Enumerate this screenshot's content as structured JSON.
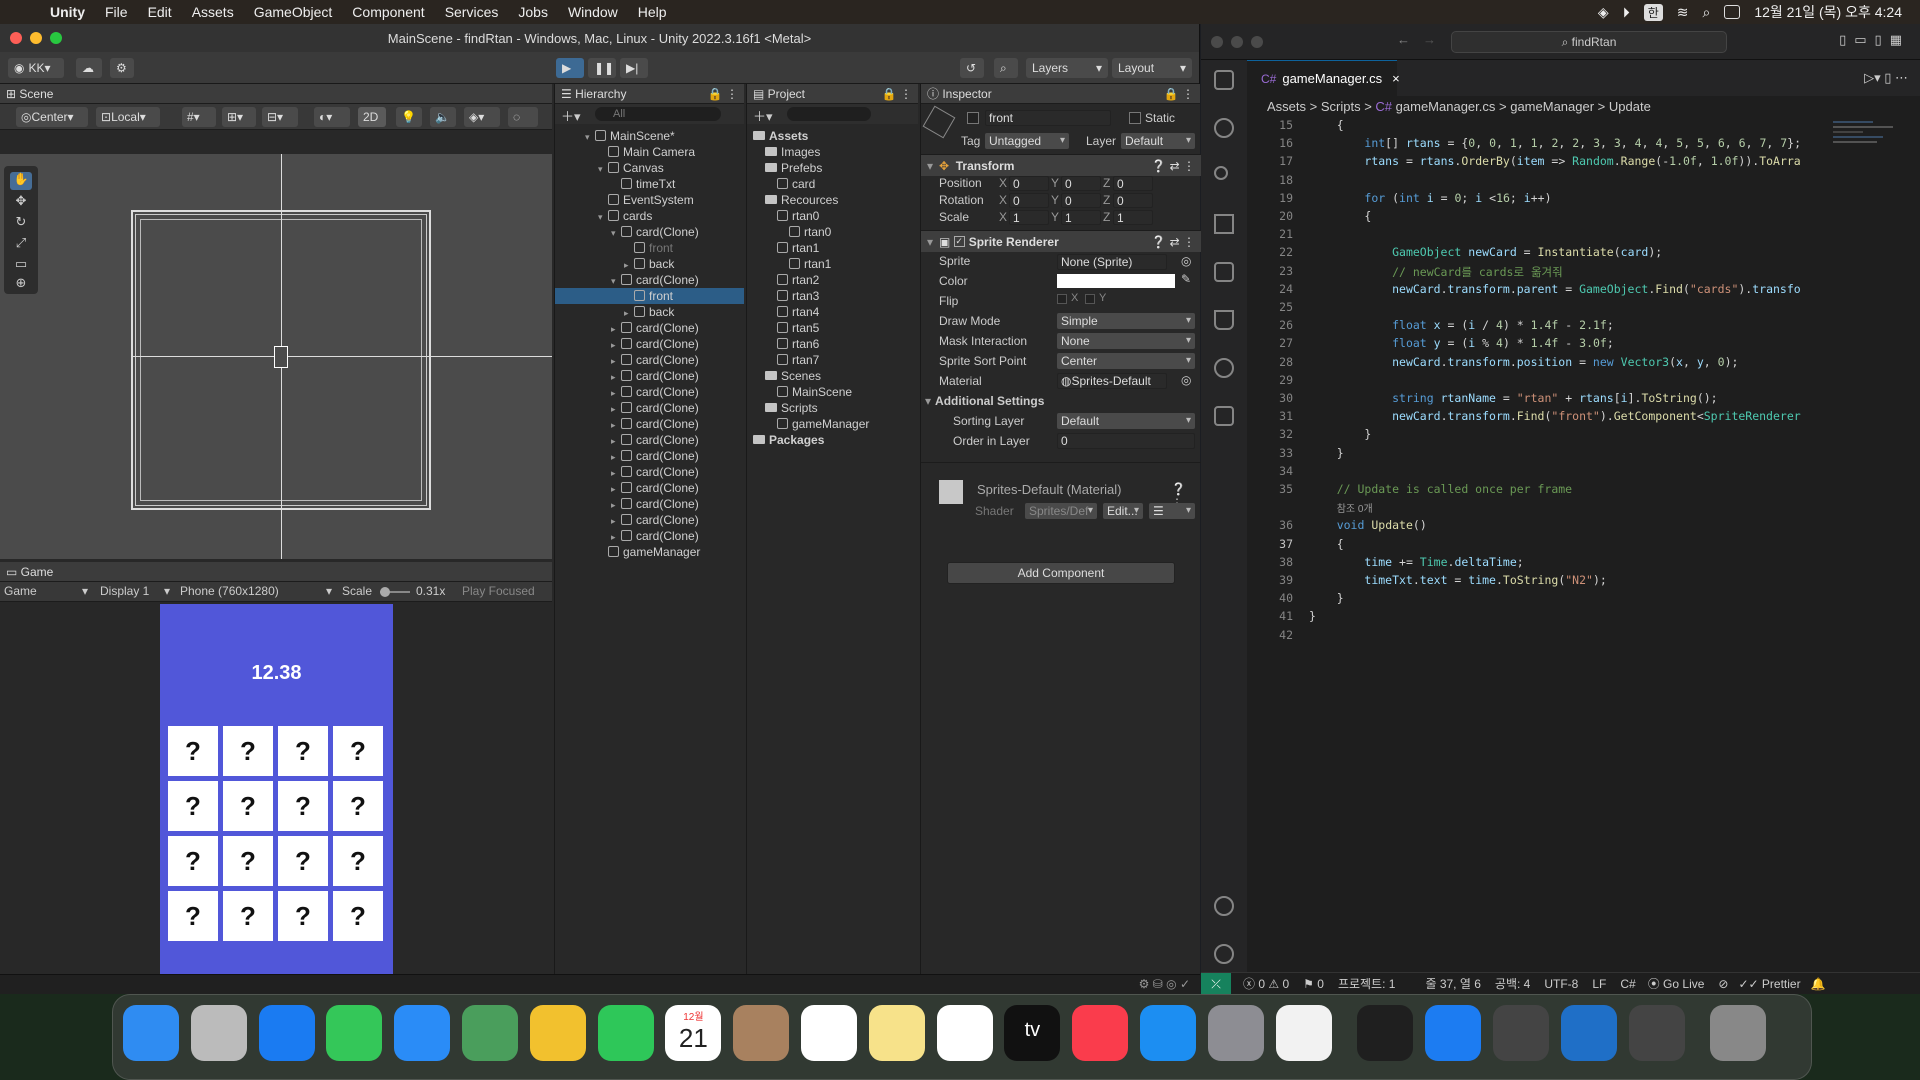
{
  "menubar": {
    "app": "Unity",
    "items": [
      "File",
      "Edit",
      "Assets",
      "GameObject",
      "Component",
      "Services",
      "Jobs",
      "Window",
      "Help"
    ],
    "input_lang": "한",
    "clock": "12월 21일 (목) 오후 4:24"
  },
  "unity": {
    "title": "MainScene - findRtan - Windows, Mac, Linux - Unity 2022.3.16f1 <Metal>",
    "account": "KK",
    "layers_label": "Layers",
    "layout_label": "Layout",
    "scene": {
      "tab": "Scene",
      "pivot": "Center",
      "space": "Local",
      "mode2d": "2D"
    },
    "game": {
      "tab": "Game",
      "mode": "Game",
      "display": "Display 1",
      "resolution": "Phone (760x1280)",
      "scale_label": "Scale",
      "scale_value": "0.31x",
      "play_focused": "Play Focused",
      "timer": "12.38",
      "card_symbol": "?"
    },
    "hierarchy": {
      "tab": "Hierarchy",
      "search_placeholder": "All",
      "rows": [
        {
          "label": "MainScene*",
          "indent": 0
        },
        {
          "label": "Main Camera",
          "indent": 1
        },
        {
          "label": "Canvas",
          "indent": 1
        },
        {
          "label": "timeTxt",
          "indent": 2
        },
        {
          "label": "EventSystem",
          "indent": 1
        },
        {
          "label": "cards",
          "indent": 1
        },
        {
          "label": "card(Clone)",
          "indent": 2
        },
        {
          "label": "front",
          "indent": 3,
          "dim": true
        },
        {
          "label": "back",
          "indent": 3
        },
        {
          "label": "card(Clone)",
          "indent": 2
        },
        {
          "label": "front",
          "indent": 3,
          "selected": true
        },
        {
          "label": "back",
          "indent": 3
        },
        {
          "label": "card(Clone)",
          "indent": 2
        },
        {
          "label": "card(Clone)",
          "indent": 2
        },
        {
          "label": "card(Clone)",
          "indent": 2
        },
        {
          "label": "card(Clone)",
          "indent": 2
        },
        {
          "label": "card(Clone)",
          "indent": 2
        },
        {
          "label": "card(Clone)",
          "indent": 2
        },
        {
          "label": "card(Clone)",
          "indent": 2
        },
        {
          "label": "card(Clone)",
          "indent": 2
        },
        {
          "label": "card(Clone)",
          "indent": 2
        },
        {
          "label": "card(Clone)",
          "indent": 2
        },
        {
          "label": "card(Clone)",
          "indent": 2
        },
        {
          "label": "card(Clone)",
          "indent": 2
        },
        {
          "label": "card(Clone)",
          "indent": 2
        },
        {
          "label": "card(Clone)",
          "indent": 2
        },
        {
          "label": "gameManager",
          "indent": 1
        }
      ]
    },
    "project": {
      "tab": "Project",
      "rows": [
        {
          "label": "Assets",
          "indent": 0,
          "bold": true
        },
        {
          "label": "Images",
          "indent": 1
        },
        {
          "label": "Prefebs",
          "indent": 1
        },
        {
          "label": "card",
          "indent": 2
        },
        {
          "label": "Recources",
          "indent": 1
        },
        {
          "label": "rtan0",
          "indent": 2
        },
        {
          "label": "rtan0",
          "indent": 3
        },
        {
          "label": "rtan1",
          "indent": 2
        },
        {
          "label": "rtan1",
          "indent": 3
        },
        {
          "label": "rtan2",
          "indent": 2
        },
        {
          "label": "rtan3",
          "indent": 2
        },
        {
          "label": "rtan4",
          "indent": 2
        },
        {
          "label": "rtan5",
          "indent": 2
        },
        {
          "label": "rtan6",
          "indent": 2
        },
        {
          "label": "rtan7",
          "indent": 2
        },
        {
          "label": "Scenes",
          "indent": 1
        },
        {
          "label": "MainScene",
          "indent": 2
        },
        {
          "label": "Scripts",
          "indent": 1
        },
        {
          "label": "gameManager",
          "indent": 2
        },
        {
          "label": "Packages",
          "indent": 0,
          "bold": true
        }
      ]
    },
    "inspector": {
      "tab": "Inspector",
      "object_name": "front",
      "static_label": "Static",
      "tag_label": "Tag",
      "tag_value": "Untagged",
      "layer_label": "Layer",
      "layer_value": "Default",
      "transform": {
        "title": "Transform",
        "rows": [
          {
            "label": "Position",
            "x": "0",
            "y": "0",
            "z": "0"
          },
          {
            "label": "Rotation",
            "x": "0",
            "y": "0",
            "z": "0"
          },
          {
            "label": "Scale",
            "x": "1",
            "y": "1",
            "z": "1"
          }
        ]
      },
      "sprite_renderer": {
        "title": "Sprite Renderer",
        "sprite_label": "Sprite",
        "sprite_value": "None (Sprite)",
        "color_label": "Color",
        "flip_label": "Flip",
        "flip_x": "X",
        "flip_y": "Y",
        "draw_mode_label": "Draw Mode",
        "draw_mode_value": "Simple",
        "mask_label": "Mask Interaction",
        "mask_value": "None",
        "sort_point_label": "Sprite Sort Point",
        "sort_point_value": "Center",
        "material_label": "Material",
        "material_value": "Sprites-Default",
        "additional_label": "Additional Settings",
        "sorting_layer_label": "Sorting Layer",
        "sorting_layer_value": "Default",
        "order_label": "Order in Layer",
        "order_value": "0"
      },
      "material": {
        "title": "Sprites-Default (Material)",
        "shader_label": "Shader",
        "shader_value": "Sprites/Def",
        "edit_label": "Edit..."
      },
      "add_component": "Add Component"
    }
  },
  "vscode": {
    "search": "findRtan",
    "tab": "gameManager.cs",
    "breadcrumbs": [
      "Assets",
      "Scripts",
      "gameManager.cs",
      "gameManager",
      "Update"
    ],
    "lines": [
      {
        "n": "15",
        "html": "    {"
      },
      {
        "n": "16",
        "html": "        <span class='kw'>int</span>[] <span class='vr'>rtans</span> = {<span class='nm'>0</span>, <span class='nm'>0</span>, <span class='nm'>1</span>, <span class='nm'>1</span>, <span class='nm'>2</span>, <span class='nm'>2</span>, <span class='nm'>3</span>, <span class='nm'>3</span>, <span class='nm'>4</span>, <span class='nm'>4</span>, <span class='nm'>5</span>, <span class='nm'>5</span>, <span class='nm'>6</span>, <span class='nm'>6</span>, <span class='nm'>7</span>, <span class='nm'>7</span>};"
      },
      {
        "n": "17",
        "html": "        <span class='vr'>rtans</span> = <span class='vr'>rtans</span>.<span class='fn'>OrderBy</span>(<span class='vr'>item</span> => <span class='ty'>Random</span>.<span class='fn'>Range</span>(-<span class='nm'>1.0f</span>, <span class='nm'>1.0f</span>)).<span class='fn'>ToArra</span>"
      },
      {
        "n": "18",
        "html": ""
      },
      {
        "n": "19",
        "html": "        <span class='kw'>for</span> (<span class='kw'>int</span> <span class='vr'>i</span> = <span class='nm'>0</span>; <span class='vr'>i</span> &lt;<span class='nm'>16</span>; <span class='vr'>i</span>++)"
      },
      {
        "n": "20",
        "html": "        {"
      },
      {
        "n": "21",
        "html": ""
      },
      {
        "n": "22",
        "html": "            <span class='ty'>GameObject</span> <span class='vr'>newCard</span> = <span class='fn'>Instantiate</span>(<span class='vr'>card</span>);"
      },
      {
        "n": "23",
        "html": "            <span class='cm'>// newCard를 cards로 옮겨줘</span>"
      },
      {
        "n": "24",
        "html": "            <span class='vr'>newCard</span>.<span class='vr'>transform</span>.<span class='vr'>parent</span> = <span class='ty'>GameObject</span>.<span class='fn'>Find</span>(<span class='st'>\"cards\"</span>).<span class='vr'>transfo</span>"
      },
      {
        "n": "25",
        "html": ""
      },
      {
        "n": "26",
        "html": "            <span class='kw'>float</span> <span class='vr'>x</span> = (<span class='vr'>i</span> / <span class='nm'>4</span>) * <span class='nm'>1.4f</span> - <span class='nm'>2.1f</span>;"
      },
      {
        "n": "27",
        "html": "            <span class='kw'>float</span> <span class='vr'>y</span> = (<span class='vr'>i</span> % <span class='nm'>4</span>) * <span class='nm'>1.4f</span> - <span class='nm'>3.0f</span>;"
      },
      {
        "n": "28",
        "html": "            <span class='vr'>newCard</span>.<span class='vr'>transform</span>.<span class='vr'>position</span> = <span class='kw'>new</span> <span class='ty'>Vector3</span>(<span class='vr'>x</span>, <span class='vr'>y</span>, <span class='nm'>0</span>);"
      },
      {
        "n": "29",
        "html": ""
      },
      {
        "n": "30",
        "html": "            <span class='kw'>string</span> <span class='vr'>rtanName</span> = <span class='st'>\"rtan\"</span> + <span class='vr'>rtans</span>[<span class='vr'>i</span>].<span class='fn'>ToString</span>();"
      },
      {
        "n": "31",
        "html": "            <span class='vr'>newCard</span>.<span class='vr'>transform</span>.<span class='fn'>Find</span>(<span class='st'>\"front\"</span>).<span class='fn'>GetComponent</span>&lt;<span class='ty'>SpriteRenderer</span>"
      },
      {
        "n": "32",
        "html": "        }"
      },
      {
        "n": "33",
        "html": "    }"
      },
      {
        "n": "34",
        "html": ""
      },
      {
        "n": "35",
        "html": "    <span class='cm'>// Update is called once per frame</span>"
      },
      {
        "n": "",
        "html": "    <span style='color:#999;font-family:Liberation Sans,sans-serif;font-size:10px'>참조 0개</span>"
      },
      {
        "n": "36",
        "html": "    <span class='kw'>void</span> <span class='fn'>Update</span>()"
      },
      {
        "n": "37",
        "html": "    {"
      },
      {
        "n": "38",
        "html": "        <span class='vr'>time</span> += <span class='ty'>Time</span>.<span class='vr'>deltaTime</span>;"
      },
      {
        "n": "39",
        "html": "        <span class='vr'>timeTxt</span>.<span class='vr'>text</span> = <span class='vr'>time</span>.<span class='fn'>ToString</span>(<span class='st'>\"N2\"</span>);"
      },
      {
        "n": "40",
        "html": "    }"
      },
      {
        "n": "41",
        "html": "}"
      },
      {
        "n": "42",
        "html": ""
      }
    ],
    "status": {
      "errors": "0",
      "warnings": "0",
      "info": "0",
      "project": "프로젝트: 1",
      "position": "줄 37, 열 6",
      "spaces": "공백: 4",
      "encoding": "UTF-8",
      "eol": "LF",
      "language": "C#",
      "golive": "Go Live",
      "prettier": "Prettier"
    }
  },
  "dock": {
    "calendar_month": "12월",
    "calendar_day": "21",
    "apps": [
      "finder-icon",
      "launchpad-icon",
      "safari-icon",
      "messages-icon",
      "mail-icon",
      "maps-icon",
      "photos-icon",
      "facetime-icon",
      "calendar-icon",
      "contacts-icon",
      "reminders-icon",
      "notes-icon",
      "freeform-icon",
      "appletv-icon",
      "music-icon",
      "appstore-icon",
      "settings-icon",
      "chrome-icon",
      "terminal-icon",
      "xcode-icon",
      "unity-hub-icon",
      "vscode-icon",
      "unity-icon",
      "trash-icon"
    ],
    "tv_label": "tv"
  }
}
